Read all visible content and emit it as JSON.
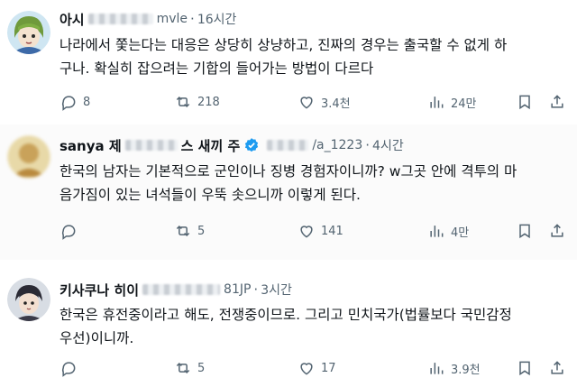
{
  "posts": [
    {
      "name": "아시",
      "handle_suffix": "mvle",
      "time": "16시간",
      "lines": [
        "나라에서 쫓는다는 대응은 상당히 상냥하고, 진짜의 경우는 출국할 수 없게 하",
        "구나. 확실히 잡으려는 기합의 들어가는 방법이 다르다"
      ],
      "replies": "8",
      "reposts": "218",
      "likes": "3.4천",
      "views": "24만"
    },
    {
      "name": "sanya 제",
      "name_suffix": "스 새끼 주",
      "handle_suffix": "/a_1223",
      "time": "4시간",
      "lines": [
        "한국의 남자는 기본적으로 군인이나 징병 경험자이니까? w그곳 안에 격투의 마",
        "음가짐이 있는 녀석들이 우뚝 솟으니까 이렇게 된다."
      ],
      "replies": "",
      "reposts": "5",
      "likes": "141",
      "views": "4만"
    },
    {
      "name": "키사쿠나 히이",
      "handle_suffix": "81JP",
      "time": "3시간",
      "lines": [
        "한국은 휴전중이라고 해도, 전쟁중이므로. 그리고 민치국가(법률보다 국민감정",
        "우선)이니까."
      ],
      "replies": "",
      "reposts": "5",
      "likes": "17",
      "views": "3.9천"
    }
  ],
  "colors": {
    "text": "#0f1419",
    "muted": "#536471",
    "verified": "#1d9bf0"
  },
  "icons": [
    "reply-icon",
    "repost-icon",
    "like-icon",
    "views-icon",
    "bookmark-icon",
    "share-icon",
    "verified-badge-icon"
  ]
}
